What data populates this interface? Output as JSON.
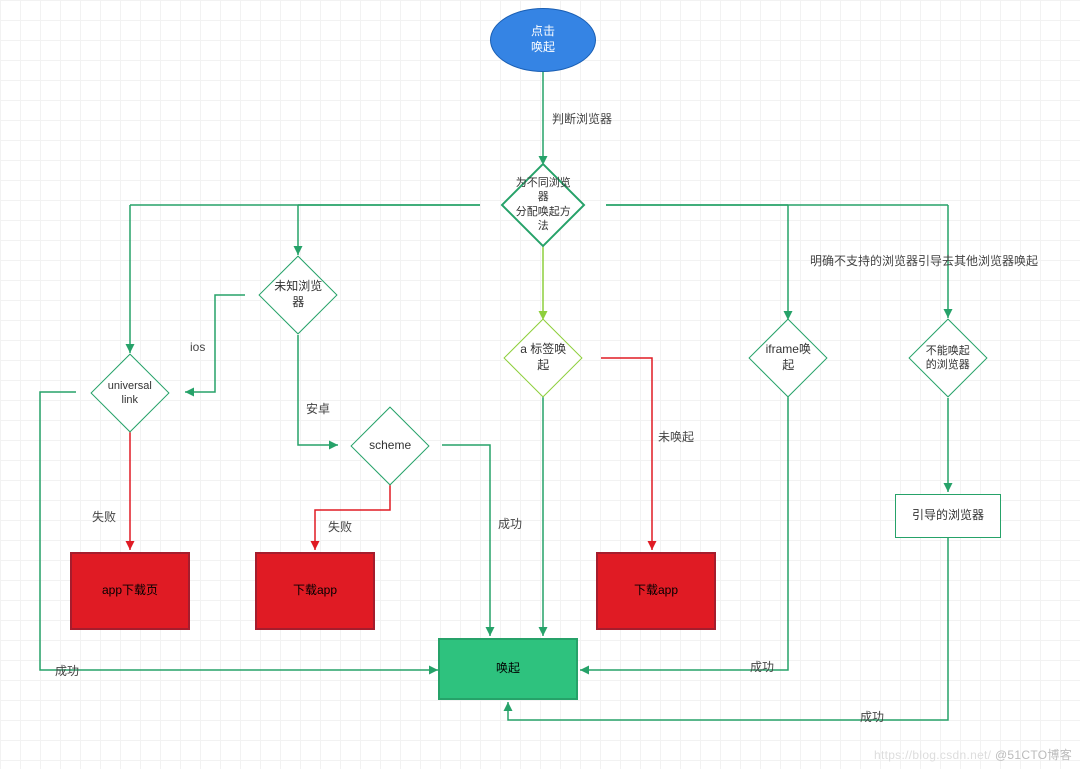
{
  "nodes": {
    "start": "点击\n唤起",
    "dispatch": "为不同浏览器\n分配唤起方法",
    "unknown": "未知浏览器",
    "universal": "universal link",
    "scheme": "scheme",
    "atag": "a 标签唤起",
    "iframe": "iframe唤起",
    "unable": "不能唤起的浏览器",
    "app_dl_page": "app下载页",
    "dl_app_1": "下载app",
    "dl_app_2": "下载app",
    "guide": "引导的浏览器",
    "awake": "唤起"
  },
  "edge_labels": {
    "judge": "判断浏览器",
    "explicit": "明确不支持的浏览器引导去其他浏览器唤起",
    "ios": "ios",
    "android": "安卓",
    "fail1": "失败",
    "fail2": "失败",
    "success1": "成功",
    "success2": "成功",
    "success3": "成功",
    "success4": "成功",
    "notawake": "未唤起"
  },
  "colors": {
    "green": "#26a269",
    "red": "#e01b24",
    "lime": "#8ecf3c",
    "blue": "#3584e4"
  },
  "watermark": "@51CTO博客",
  "watermark_faint": "https://blog.csdn.net/"
}
